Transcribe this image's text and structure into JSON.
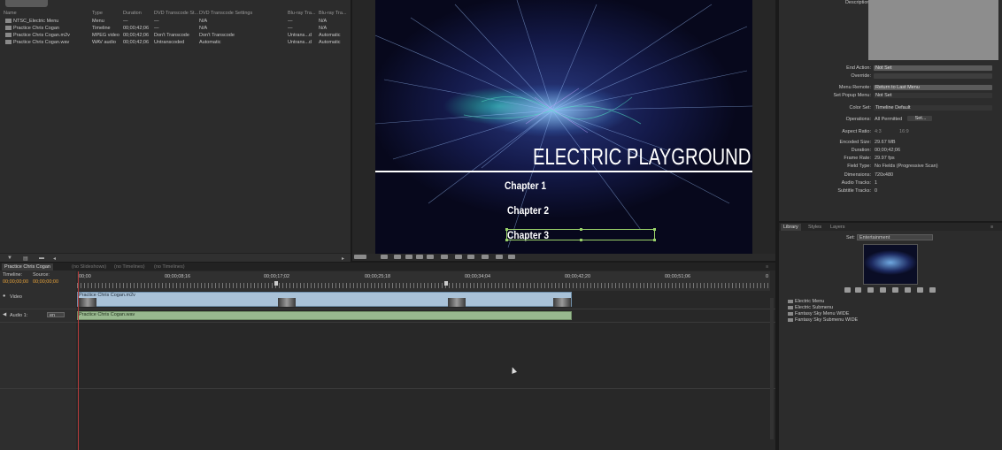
{
  "project": {
    "columns": [
      "Name",
      "Type",
      "Duration",
      "DVD Transcode St...",
      "DVD Transcode Settings",
      "Blu-ray Tra...",
      "Blu-ray Tra..."
    ],
    "rows": [
      {
        "name": "NTSC_Electric Menu",
        "type": "Menu",
        "duration": "—",
        "dvd_status": "—",
        "dvd_settings": "N/A",
        "bd_status": "—",
        "bd_settings": "N/A"
      },
      {
        "name": "Practice Chris Cogan",
        "type": "Timeline",
        "duration": "00;00;42;06",
        "dvd_status": "—",
        "dvd_settings": "N/A",
        "bd_status": "—",
        "bd_settings": "N/A"
      },
      {
        "name": "Practice Chris Cogan.m2v",
        "type": "MPEG video",
        "duration": "00;00;42;06",
        "dvd_status": "Don't Transcode",
        "dvd_settings": "Don't Transcode",
        "bd_status": "Untrans...d",
        "bd_settings": "Automatic"
      },
      {
        "name": "Practice Chris Cogan.wav",
        "type": "WAV audio",
        "duration": "00;00;42;06",
        "dvd_status": "Untranscoded",
        "dvd_settings": "Automatic",
        "bd_status": "Untrans...d",
        "bd_settings": "Automatic"
      }
    ]
  },
  "monitor": {
    "menu_title": "ELECTRIC PLAYGROUND",
    "buttons": [
      "Chapter 1",
      "Chapter 2",
      "Chapter 3"
    ]
  },
  "properties": {
    "description_label": "Description:",
    "end_action_label": "End Action:",
    "end_action_value": "Not Set",
    "override_label": "Override:",
    "menu_remote_label": "Menu Remote:",
    "menu_remote_value": "Return to Last Menu",
    "popup_label": "Set Popup Menu:",
    "popup_value": "Not Set",
    "color_set_label": "Color Set:",
    "color_set_value": "Timeline Default",
    "operations_label": "Operations:",
    "operations_value": "All Permitted",
    "operations_button": "Set...",
    "aspect_label": "Aspect Ratio:",
    "aspect_43": "4:3",
    "aspect_169": "16:9",
    "encoded_size_label": "Encoded Size:",
    "encoded_size": "29.67 MB",
    "duration_label": "Duration:",
    "duration": "00;00;42;06",
    "frame_rate_label": "Frame Rate:",
    "frame_rate": "29.97 fps",
    "field_type_label": "Field Type:",
    "field_type": "No Fields (Progressive Scan)",
    "dimensions_label": "Dimensions:",
    "dimensions": "720x480",
    "audio_tracks_label": "Audio Tracks:",
    "audio_tracks": "1",
    "subtitle_tracks_label": "Subtitle Tracks:",
    "subtitle_tracks": "0"
  },
  "library": {
    "tabs": [
      "Library",
      "Styles",
      "Layers"
    ],
    "set_label": "Set:",
    "set_value": "Entertainment",
    "items": [
      "Electric Menu",
      "Electric Submenu",
      "Fantasy Sky Menu WIDE",
      "Fantasy Sky Submenu WIDE"
    ]
  },
  "timeline": {
    "tabs": [
      "Practice Chris Cogan",
      "(no Slideshows)",
      "(no Timelines)",
      "(no Timelines)"
    ],
    "timeline_label": "Timeline:",
    "source_label": "Source:",
    "timeline_tc": "00;00;00;00",
    "source_tc": "00;00;00;00",
    "ruler": [
      "00;00",
      "00;00;08;16",
      "00;00;17;02",
      "00;00;25;18",
      "00;00;34;04",
      "00;00;42;20",
      "00;00;51;06",
      "0"
    ],
    "video_track": "Video",
    "audio_track": "Audio 1:",
    "audio_lang": "en",
    "video_clip": "Practice Chris Cogan.m2v",
    "audio_clip": "Practice Chris Cogan.wav"
  }
}
